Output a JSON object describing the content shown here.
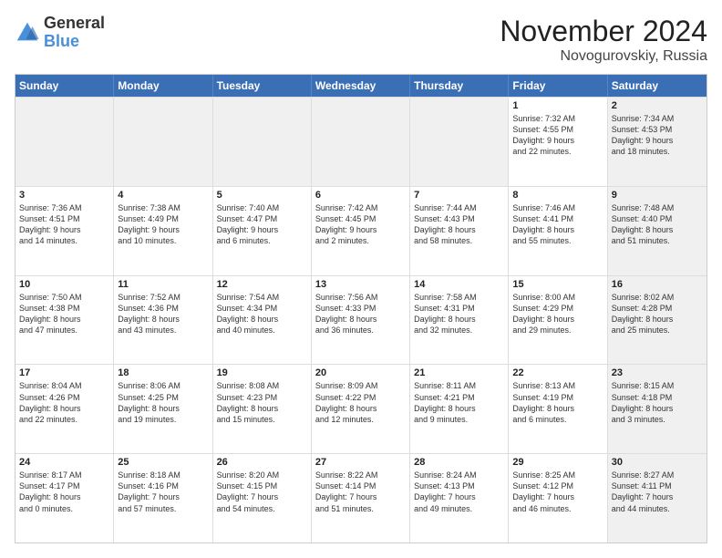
{
  "header": {
    "logo_line1": "General",
    "logo_line2": "Blue",
    "month": "November 2024",
    "location": "Novogurovskiy, Russia"
  },
  "days_of_week": [
    "Sunday",
    "Monday",
    "Tuesday",
    "Wednesday",
    "Thursday",
    "Friday",
    "Saturday"
  ],
  "weeks": [
    [
      {
        "day": "",
        "info": "",
        "shaded": true
      },
      {
        "day": "",
        "info": "",
        "shaded": true
      },
      {
        "day": "",
        "info": "",
        "shaded": true
      },
      {
        "day": "",
        "info": "",
        "shaded": true
      },
      {
        "day": "",
        "info": "",
        "shaded": true
      },
      {
        "day": "1",
        "info": "Sunrise: 7:32 AM\nSunset: 4:55 PM\nDaylight: 9 hours\nand 22 minutes.",
        "shaded": false
      },
      {
        "day": "2",
        "info": "Sunrise: 7:34 AM\nSunset: 4:53 PM\nDaylight: 9 hours\nand 18 minutes.",
        "shaded": true
      }
    ],
    [
      {
        "day": "3",
        "info": "Sunrise: 7:36 AM\nSunset: 4:51 PM\nDaylight: 9 hours\nand 14 minutes.",
        "shaded": false
      },
      {
        "day": "4",
        "info": "Sunrise: 7:38 AM\nSunset: 4:49 PM\nDaylight: 9 hours\nand 10 minutes.",
        "shaded": false
      },
      {
        "day": "5",
        "info": "Sunrise: 7:40 AM\nSunset: 4:47 PM\nDaylight: 9 hours\nand 6 minutes.",
        "shaded": false
      },
      {
        "day": "6",
        "info": "Sunrise: 7:42 AM\nSunset: 4:45 PM\nDaylight: 9 hours\nand 2 minutes.",
        "shaded": false
      },
      {
        "day": "7",
        "info": "Sunrise: 7:44 AM\nSunset: 4:43 PM\nDaylight: 8 hours\nand 58 minutes.",
        "shaded": false
      },
      {
        "day": "8",
        "info": "Sunrise: 7:46 AM\nSunset: 4:41 PM\nDaylight: 8 hours\nand 55 minutes.",
        "shaded": false
      },
      {
        "day": "9",
        "info": "Sunrise: 7:48 AM\nSunset: 4:40 PM\nDaylight: 8 hours\nand 51 minutes.",
        "shaded": true
      }
    ],
    [
      {
        "day": "10",
        "info": "Sunrise: 7:50 AM\nSunset: 4:38 PM\nDaylight: 8 hours\nand 47 minutes.",
        "shaded": false
      },
      {
        "day": "11",
        "info": "Sunrise: 7:52 AM\nSunset: 4:36 PM\nDaylight: 8 hours\nand 43 minutes.",
        "shaded": false
      },
      {
        "day": "12",
        "info": "Sunrise: 7:54 AM\nSunset: 4:34 PM\nDaylight: 8 hours\nand 40 minutes.",
        "shaded": false
      },
      {
        "day": "13",
        "info": "Sunrise: 7:56 AM\nSunset: 4:33 PM\nDaylight: 8 hours\nand 36 minutes.",
        "shaded": false
      },
      {
        "day": "14",
        "info": "Sunrise: 7:58 AM\nSunset: 4:31 PM\nDaylight: 8 hours\nand 32 minutes.",
        "shaded": false
      },
      {
        "day": "15",
        "info": "Sunrise: 8:00 AM\nSunset: 4:29 PM\nDaylight: 8 hours\nand 29 minutes.",
        "shaded": false
      },
      {
        "day": "16",
        "info": "Sunrise: 8:02 AM\nSunset: 4:28 PM\nDaylight: 8 hours\nand 25 minutes.",
        "shaded": true
      }
    ],
    [
      {
        "day": "17",
        "info": "Sunrise: 8:04 AM\nSunset: 4:26 PM\nDaylight: 8 hours\nand 22 minutes.",
        "shaded": false
      },
      {
        "day": "18",
        "info": "Sunrise: 8:06 AM\nSunset: 4:25 PM\nDaylight: 8 hours\nand 19 minutes.",
        "shaded": false
      },
      {
        "day": "19",
        "info": "Sunrise: 8:08 AM\nSunset: 4:23 PM\nDaylight: 8 hours\nand 15 minutes.",
        "shaded": false
      },
      {
        "day": "20",
        "info": "Sunrise: 8:09 AM\nSunset: 4:22 PM\nDaylight: 8 hours\nand 12 minutes.",
        "shaded": false
      },
      {
        "day": "21",
        "info": "Sunrise: 8:11 AM\nSunset: 4:21 PM\nDaylight: 8 hours\nand 9 minutes.",
        "shaded": false
      },
      {
        "day": "22",
        "info": "Sunrise: 8:13 AM\nSunset: 4:19 PM\nDaylight: 8 hours\nand 6 minutes.",
        "shaded": false
      },
      {
        "day": "23",
        "info": "Sunrise: 8:15 AM\nSunset: 4:18 PM\nDaylight: 8 hours\nand 3 minutes.",
        "shaded": true
      }
    ],
    [
      {
        "day": "24",
        "info": "Sunrise: 8:17 AM\nSunset: 4:17 PM\nDaylight: 8 hours\nand 0 minutes.",
        "shaded": false
      },
      {
        "day": "25",
        "info": "Sunrise: 8:18 AM\nSunset: 4:16 PM\nDaylight: 7 hours\nand 57 minutes.",
        "shaded": false
      },
      {
        "day": "26",
        "info": "Sunrise: 8:20 AM\nSunset: 4:15 PM\nDaylight: 7 hours\nand 54 minutes.",
        "shaded": false
      },
      {
        "day": "27",
        "info": "Sunrise: 8:22 AM\nSunset: 4:14 PM\nDaylight: 7 hours\nand 51 minutes.",
        "shaded": false
      },
      {
        "day": "28",
        "info": "Sunrise: 8:24 AM\nSunset: 4:13 PM\nDaylight: 7 hours\nand 49 minutes.",
        "shaded": false
      },
      {
        "day": "29",
        "info": "Sunrise: 8:25 AM\nSunset: 4:12 PM\nDaylight: 7 hours\nand 46 minutes.",
        "shaded": false
      },
      {
        "day": "30",
        "info": "Sunrise: 8:27 AM\nSunset: 4:11 PM\nDaylight: 7 hours\nand 44 minutes.",
        "shaded": true
      }
    ]
  ]
}
